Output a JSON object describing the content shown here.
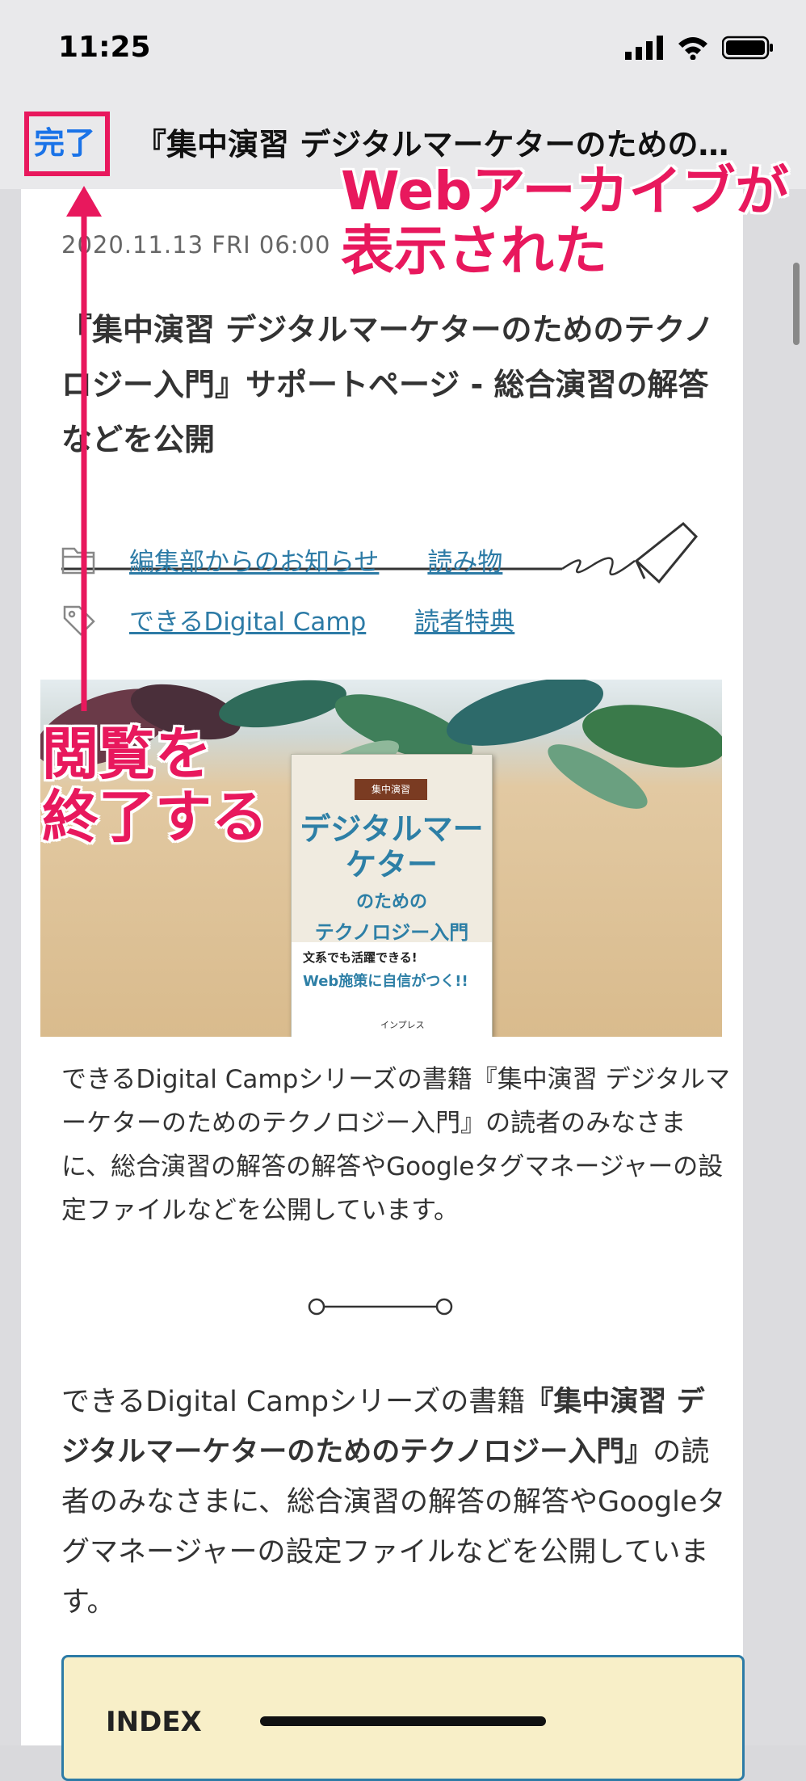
{
  "status_bar": {
    "time": "11:25"
  },
  "nav": {
    "done_label": "完了",
    "title": "『集中演習 デジタルマーケターのための…"
  },
  "article": {
    "date": "2020.11.13 FRI 06:00",
    "headline": "『集中演習 デジタルマーケターのためのテクノロジー入門』サポートページ - 総合演習の解答などを公開",
    "categories": [
      "編集部からのお知らせ",
      "読み物"
    ],
    "tags": [
      "できるDigital Camp",
      "読者特典"
    ],
    "hero": {
      "book_label": "集中演習",
      "book_title": "デジタルマーケター",
      "book_sub": "のための",
      "book_sub2": "テクノロジー入門",
      "band_text1": "文系でも活躍できる!",
      "band_text2": "Web施策に自信がつく!!",
      "publisher": "インプレス"
    },
    "para1": "できるDigital Campシリーズの書籍『集中演習 デジタルマーケターのためのテクノロジー入門』の読者のみなさまに、総合演習の解答の解答やGoogleタグマネージャーの設定ファイルなどを公開しています。",
    "para2_pre": "できるDigital Campシリーズの書籍",
    "para2_bold": "『集中演習 デジタルマーケターのためのテクノロジー入門』",
    "para2_post": "の読者のみなさまに、総合演習の解答の解答やGoogleタグマネージャーの設定ファイルなどを公開しています。",
    "index_title": "INDEX"
  },
  "annotations": {
    "top_line1": "Webアーカイブが",
    "top_line2": "表示された",
    "left_line1": "閲覧を",
    "left_line2": "終了する",
    "color": "#e8185d"
  }
}
